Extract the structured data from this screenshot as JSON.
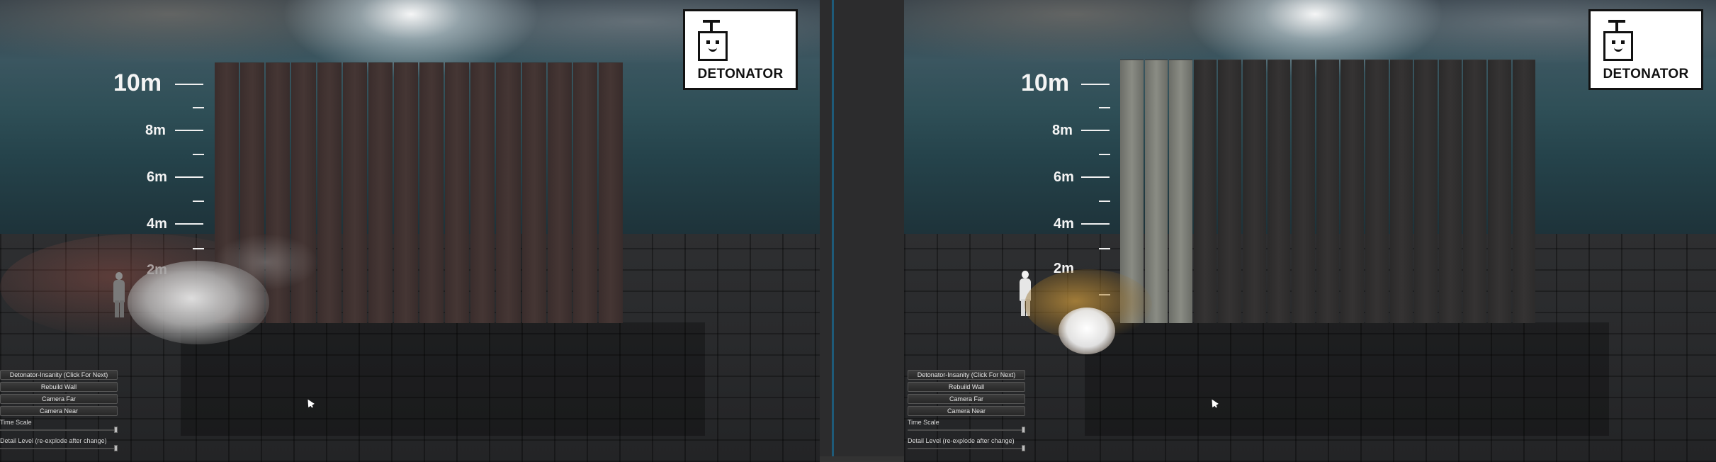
{
  "logo": {
    "text": "DETONATOR",
    "icon": "detonator-icon"
  },
  "ruler": {
    "labels": [
      "10m",
      "8m",
      "6m",
      "4m",
      "2m"
    ],
    "unit": "m"
  },
  "ui_panel": {
    "buttons": [
      "Detonator-Insanity (Click For Next)",
      "Rebuild Wall",
      "Camera Far",
      "Camera Near"
    ],
    "time_scale_label": "Time Scale",
    "detail_level_label": "Detail Level (re-explode after change)"
  },
  "colors": {
    "divider_accent": "#1e5a78",
    "logo_bg": "#ffffff",
    "ui_text": "#e6e6e6"
  },
  "views": {
    "left": {
      "explosion_style": "grey smoke cloud"
    },
    "right": {
      "explosion_style": "fiery white-yellow burst"
    }
  }
}
